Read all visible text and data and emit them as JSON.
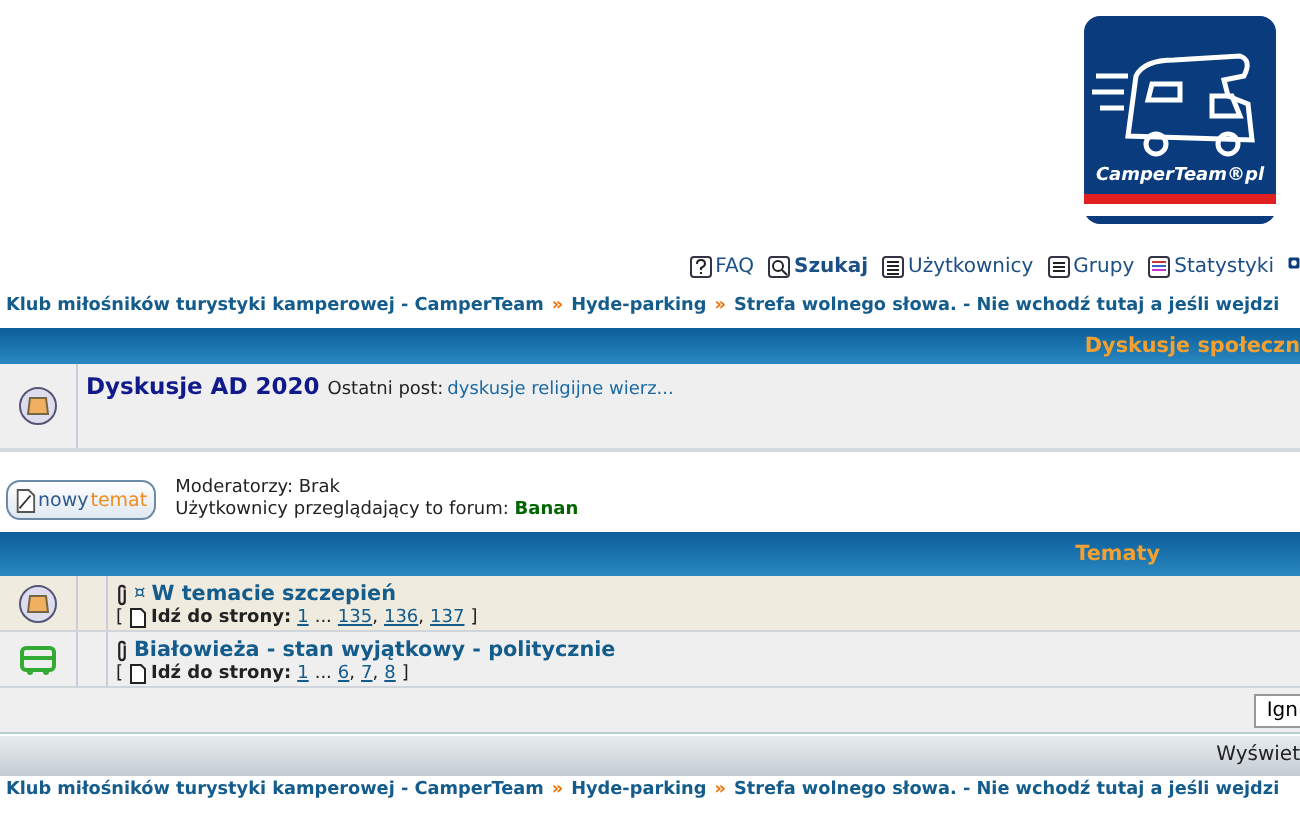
{
  "logo": {
    "text": "CamperTeam®pl"
  },
  "nav": [
    {
      "label": "FAQ",
      "bold": false
    },
    {
      "label": "Szukaj",
      "bold": true
    },
    {
      "label": "Użytkownicy",
      "bold": false
    },
    {
      "label": "Grupy",
      "bold": false
    },
    {
      "label": "Statystyki",
      "bold": false
    }
  ],
  "breadcrumb_top": {
    "separator": "»",
    "items": [
      "Klub miłośników turystyki kamperowej - CamperTeam",
      "Hyde-parking",
      "Strefa wolnego słowa. - Nie wchodź tutaj a jeśli wejdzi"
    ]
  },
  "forum_section": {
    "header": "Dyskusje społeczn",
    "forums": [
      {
        "title": "Dyskusje AD 2020",
        "last_post_label": "Ostatni post:",
        "last_post": "dyskusje religijne wierz..."
      }
    ]
  },
  "new_topic_button": {
    "word1": "nowy",
    "word2": "temat"
  },
  "info": {
    "moderators": "Moderatorzy: Brak",
    "viewers_label": "Użytkownicy przeglądający to forum:",
    "viewers": [
      {
        "name": "Banan",
        "color": "#006600"
      }
    ]
  },
  "topics_section": {
    "header": "Tematy",
    "topics": [
      {
        "kind": "folder",
        "attachment": true,
        "mark": "¤",
        "title": "W temacie szczepień",
        "open": "[",
        "label": "Idź do strony:",
        "first": "1",
        "gap": "...",
        "rest": [
          "135",
          "136",
          "137"
        ],
        "sep": ",",
        "close": "]"
      },
      {
        "kind": "camper",
        "attachment": true,
        "title": "Białowieża - stan wyjątkowy - politycznie",
        "open": "[",
        "label": "Idź do strony:",
        "first": "1",
        "gap": "...",
        "rest": [
          "6",
          "7",
          "8"
        ],
        "sep": ",",
        "close": "]"
      }
    ]
  },
  "ignore_button": "Ign",
  "display_bar": "Wyświet",
  "breadcrumb_bottom": {
    "separator": "»",
    "items": [
      "Klub miłośników turystyki kamperowej - CamperTeam",
      "Hyde-parking",
      "Strefa wolnego słowa. - Nie wchodź tutaj a jeśli wejdzi"
    ]
  }
}
